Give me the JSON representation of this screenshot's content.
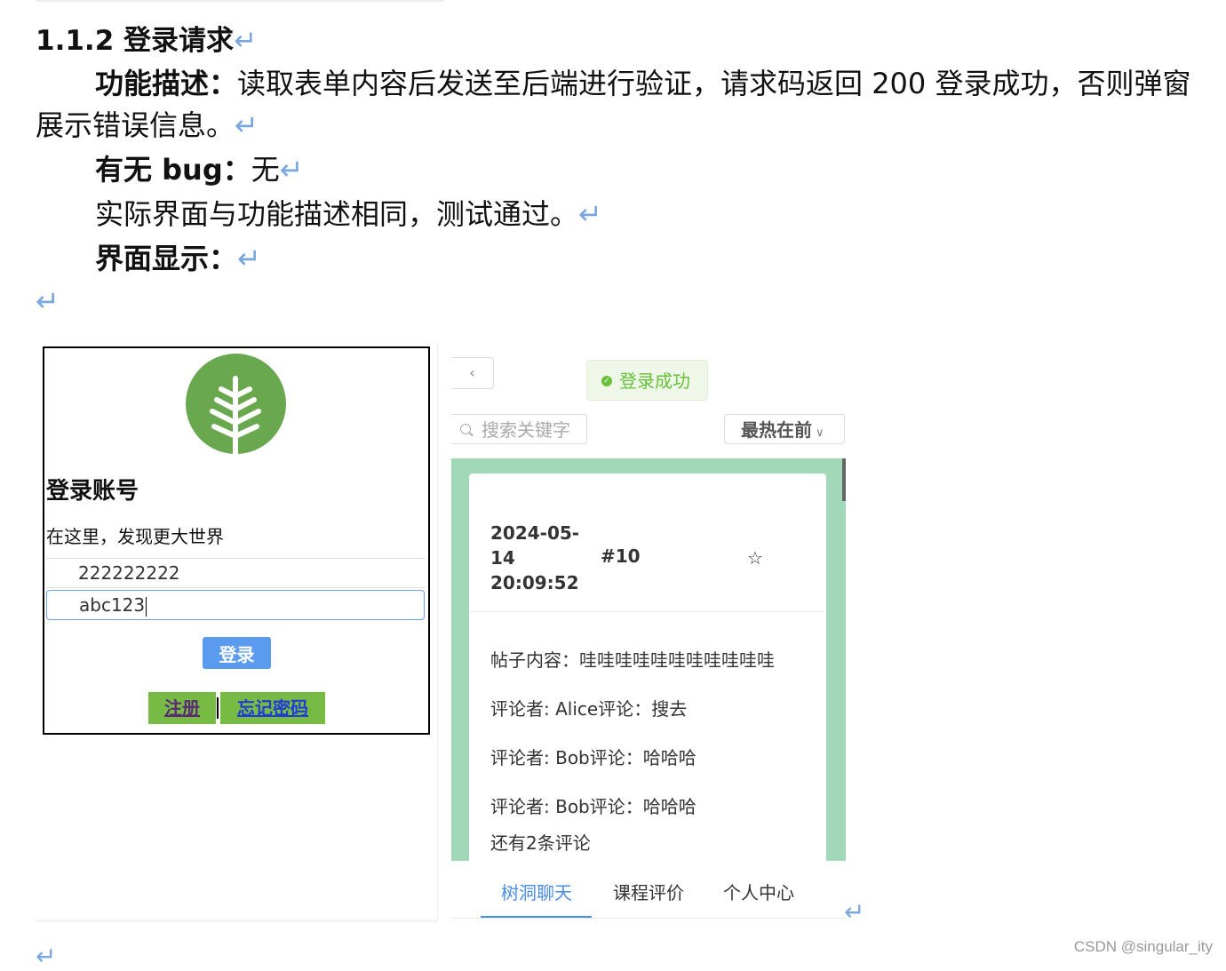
{
  "doc": {
    "heading": "1.1.2 登录请求",
    "return_mark": "↵",
    "desc_label": "功能描述：",
    "desc_text_1": "读取表单内容后发送至后端进行验证，请求码返回 200 登录成功，否则弹窗",
    "desc_text_2": "展示错误信息。",
    "bug_label": "有无 bug：",
    "bug_value": "无",
    "result_text": "实际界面与功能描述相同，测试通过。",
    "display_label": "界面显示："
  },
  "login": {
    "title": "登录账号",
    "subtitle": "在这里，发现更大世界",
    "account_value": "222222222",
    "password_value": "abc123",
    "login_button": "登录",
    "register_link": "注册",
    "forgot_link": "忘记密码",
    "logo_color": "#6aa84f"
  },
  "app": {
    "back_icon": "chevron-left-icon",
    "toast_text": "登录成功",
    "toast_color": "#67c23a",
    "search_placeholder": "搜索关键字",
    "sort_value": "最热在前",
    "feed_bg_color": "#a0d8b8",
    "post": {
      "date": "2024-05-14 20:09:52",
      "number": "#10",
      "star_icon": "star-outline-icon",
      "content": "帖子内容：哇哇哇哇哇哇哇哇哇哇哇",
      "comments": [
        "评论者: Alice评论：搜去",
        "评论者: Bob评论：哈哈哈",
        "评论者: Bob评论：哈哈哈"
      ],
      "more": "还有2条评论"
    },
    "tabs": [
      "树洞聊天",
      "课程评价",
      "个人中心"
    ],
    "active_tab_color": "#4a8de8"
  },
  "footer": "CSDN @singular_ity"
}
